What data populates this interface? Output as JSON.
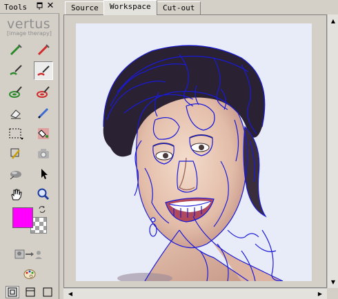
{
  "tools_panel": {
    "title": "Tools",
    "pin_icon": "pin-icon",
    "close_label": "✕"
  },
  "logo": {
    "name": "vertus",
    "tagline": "[image therapy]"
  },
  "colors": {
    "foreground": "#ff00ff",
    "contour": "#1a1ad8",
    "active_tab_bg": "#e4e2dc"
  },
  "tabs": [
    {
      "label": "Source"
    },
    {
      "label": "Workspace"
    },
    {
      "label": "Cut-out"
    }
  ],
  "active_tab": "Workspace",
  "tools": [
    "keep-marker-icon",
    "erase-marker-icon",
    "keep-brush-icon",
    "erase-brush-icon",
    "keep-smart-brush-icon",
    "erase-smart-brush-icon",
    "eraser-icon",
    "pen-icon",
    "rect-select-icon",
    "bucket-icon",
    "pick-icon",
    "camera-icon",
    "smudge-icon",
    "pointer-icon",
    "hand-icon",
    "zoom-icon"
  ],
  "scroll_arrows": {
    "up": "▲",
    "down": "▼",
    "left": "◀",
    "right": "▶"
  }
}
